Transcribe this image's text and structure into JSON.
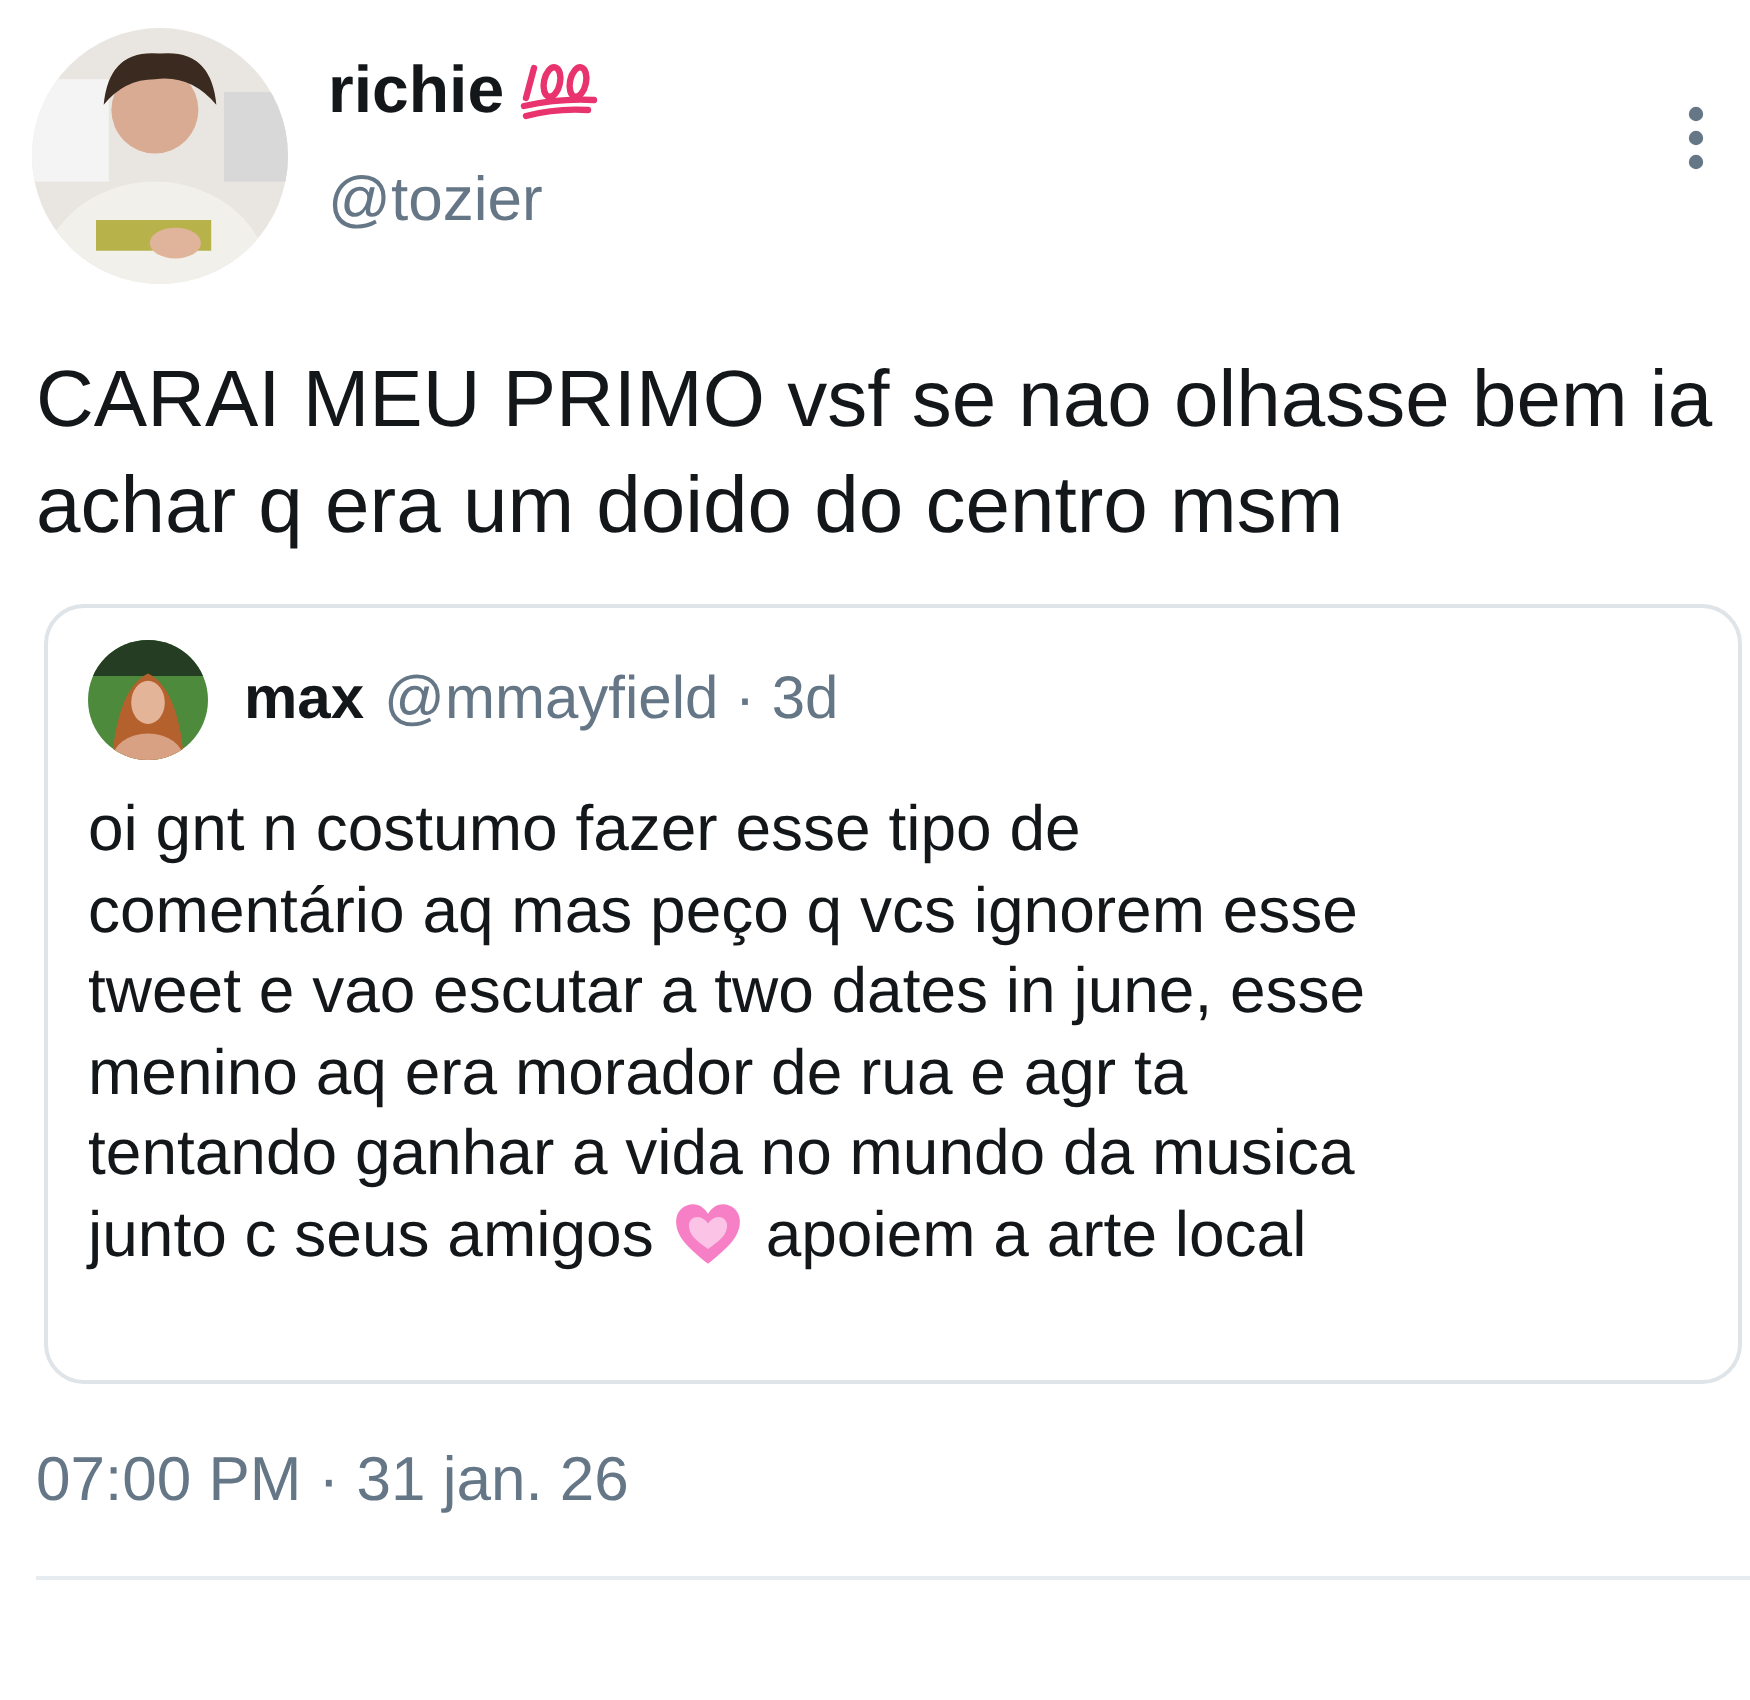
{
  "tweet": {
    "display_name": "richie",
    "name_emoji": {
      "kind": "hundred-points"
    },
    "handle": "@tozier",
    "text": "CARAI MEU PRIMO vsf se nao olhasse bem ia achar q era um doido do centro msm",
    "quote": {
      "display_name": "max",
      "handle": "@mmayfield · 3d",
      "lines": [
        [
          {
            "kind": "text",
            "text": "oi gnt n costumo fazer esse tipo de"
          }
        ],
        [
          {
            "kind": "text",
            "text": "comentário aq mas peço q vcs ignorem esse"
          }
        ],
        [
          {
            "kind": "text",
            "text": "tweet e vao escutar a two dates in june, esse"
          }
        ],
        [
          {
            "kind": "text",
            "text": "menino aq era morador de rua e agr ta"
          }
        ],
        [
          {
            "kind": "text",
            "text": "tentando ganhar a vida no mundo da musica"
          }
        ],
        [
          {
            "kind": "text",
            "text": "junto c seus amigos"
          },
          {
            "kind": "heart"
          },
          {
            "kind": "text",
            "text": "apoiem a arte local"
          }
        ]
      ]
    },
    "timestamp": "07:00 PM · 31 jan. 26"
  }
}
